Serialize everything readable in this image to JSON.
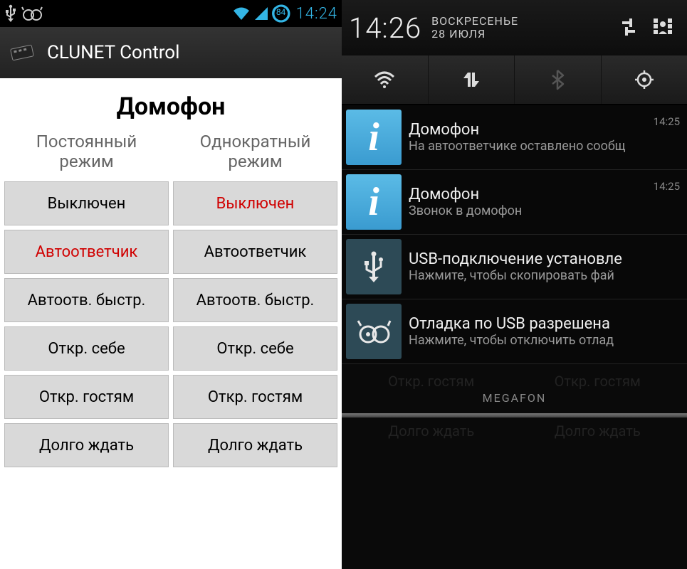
{
  "left": {
    "statusbar": {
      "battery_pct": "84",
      "clock": "14:24"
    },
    "actionbar": {
      "title": "CLUNET Control"
    },
    "page_title": "Домофон",
    "col_headers": {
      "left": "Постоянный\nрежим",
      "right": "Однократный\nрежим"
    },
    "modes": {
      "left": [
        {
          "label": "Выключен",
          "selected": false
        },
        {
          "label": "Автоответчик",
          "selected": true
        },
        {
          "label": "Автоотв. быстр.",
          "selected": false
        },
        {
          "label": "Откр. себе",
          "selected": false
        },
        {
          "label": "Откр. гостям",
          "selected": false
        },
        {
          "label": "Долго ждать",
          "selected": false
        }
      ],
      "right": [
        {
          "label": "Выключен",
          "selected": true
        },
        {
          "label": "Автоответчик",
          "selected": false
        },
        {
          "label": "Автоотв. быстр.",
          "selected": false
        },
        {
          "label": "Откр. себе",
          "selected": false
        },
        {
          "label": "Откр. гостям",
          "selected": false
        },
        {
          "label": "Долго ждать",
          "selected": false
        }
      ]
    }
  },
  "right": {
    "header": {
      "clock": "14:26",
      "day": "ВОСКРЕСЕНЬЕ",
      "date": "28 ИЮЛЯ"
    },
    "notifications": [
      {
        "icon": "info",
        "title": "Домофон",
        "subtitle": "На автоответчике оставлено сообщ",
        "time": "14:25"
      },
      {
        "icon": "info",
        "title": "Домофон",
        "subtitle": "Звонок в домофон",
        "time": "14:25"
      },
      {
        "icon": "usb",
        "title": "USB-подключение установле",
        "subtitle": "Нажмите, чтобы скопировать фай",
        "time": ""
      },
      {
        "icon": "cyan",
        "title": "Отладка по USB разрешена",
        "subtitle": "Нажмите, чтобы отключить отлад",
        "time": ""
      }
    ],
    "carrier": "MEGAFON",
    "dimmed": {
      "row1": [
        "Откр. гостям",
        "Откр. гостям"
      ],
      "row2": [
        "Долго ждать",
        "Долго ждать"
      ]
    }
  }
}
